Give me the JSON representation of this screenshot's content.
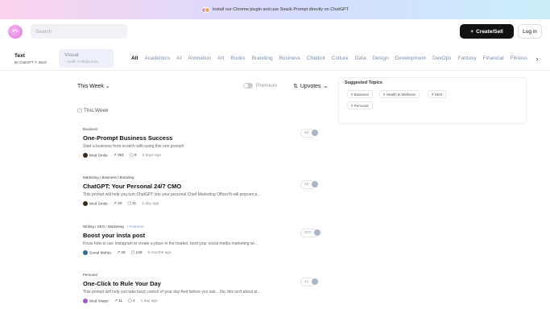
{
  "banner": {
    "text": "Install our Chrome plugin and use Snack Prompt directly on ChatGPT"
  },
  "header": {
    "search_placeholder": "Search",
    "create_label": "Create/Sell",
    "login_label": "Log in"
  },
  "filters": {
    "text_label": "Text",
    "text_sub": "⊞ ChatGPT  ✎ Bard",
    "visual_label": "Visual",
    "visual_sub": "○ Dalle  ⊙ Midjourney",
    "categories": [
      "All",
      "Academics",
      "AI",
      "Animation",
      "Art",
      "Books",
      "Branding",
      "Business",
      "Chatbot",
      "Culture",
      "Data",
      "Design",
      "Development",
      "DevOps",
      "Fantasy",
      "Financial",
      "Fitness"
    ]
  },
  "sort": {
    "period": "This Week",
    "premium": "Premium",
    "order": "Upvotes"
  },
  "section_label": "This Week",
  "prompts": [
    {
      "tags": "Business",
      "featured": "",
      "title": "One-Prompt Business Success",
      "desc": "Start a business from scratch with using this one prompt!",
      "author": "Mod Smile",
      "upvotes": "391",
      "comments": "8",
      "time": "3 days ago",
      "count": "92",
      "avatar_color": "#3a2a1a"
    },
    {
      "tags": "Marketing / Business / Branding",
      "featured": "",
      "title": "ChatGPT: Your Personal 24/7 CMO",
      "desc": "This prompt will help you turn ChatGPT into your personal Chief Marketing Officer!It will pinpoint p...",
      "author": "Mod Smile",
      "upvotes": "30",
      "comments": "11",
      "time": "1 day ago",
      "count": "16",
      "avatar_color": "#3a2a1a"
    },
    {
      "tags": "Writing / SEO / Marketing",
      "featured": "• Featured",
      "title": "Boost your insta post",
      "desc": "Know how to use Instagram to create a place in the market, boot your social media marketing wi...",
      "author": "Sonal Mehta",
      "upvotes": "26",
      "comments": "128",
      "time": "5 months ago",
      "count": "223",
      "avatar_color": "#2b6c8f"
    },
    {
      "tags": "Personal",
      "featured": "",
      "title": "One-Click to Rule Your Day",
      "desc": "This prompt will help you take back control of your day And before you ask... No, this isn't about pl...",
      "author": "Mod Swipe",
      "upvotes": "11",
      "comments": "4",
      "time": "1 day ago",
      "count": "14",
      "avatar_color": "#9a5ac8"
    }
  ],
  "sidebar": {
    "heading": "Suggested Topics",
    "topics": [
      "# Business",
      "# Health & Wellness",
      "# SEO",
      "# Personal"
    ]
  }
}
